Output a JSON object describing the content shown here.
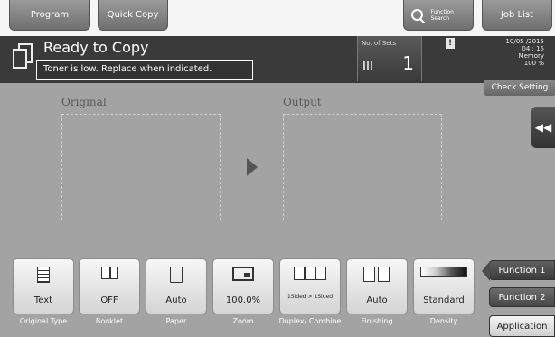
{
  "topbar": {
    "program": "Program",
    "quick_copy": "Quick Copy",
    "function_search": "Function Search",
    "job_list": "Job List"
  },
  "status": {
    "title": "Ready to Copy",
    "message": "Toner is low. Replace when indicated.",
    "sets_label": "No. of Sets",
    "sets_value": "1",
    "date": "10/05 /2015",
    "time": "04 : 15",
    "memory_label": "Memory",
    "memory_value": "100 %",
    "check_setting": "Check Setting"
  },
  "preview": {
    "original_label": "Original",
    "output_label": "Output"
  },
  "settings": [
    {
      "value": "Text",
      "caption": "Original Type",
      "icon": "text-document-icon"
    },
    {
      "value": "OFF",
      "caption": "Booklet",
      "icon": "booklet-icon"
    },
    {
      "value": "Auto",
      "caption": "Paper",
      "icon": "paper-icon"
    },
    {
      "value": "100.0%",
      "caption": "Zoom",
      "icon": "zoom-icon"
    },
    {
      "value": "1Sided > 1Sided",
      "caption": "Duplex/ Combine",
      "icon": "duplex-icon"
    },
    {
      "value": "Auto",
      "caption": "Finishing",
      "icon": "finishing-icon"
    },
    {
      "value": "Standard",
      "caption": "Density",
      "icon": "density-icon"
    }
  ],
  "side": {
    "function1": "Function 1",
    "function2": "Function 2",
    "application": "Application"
  }
}
